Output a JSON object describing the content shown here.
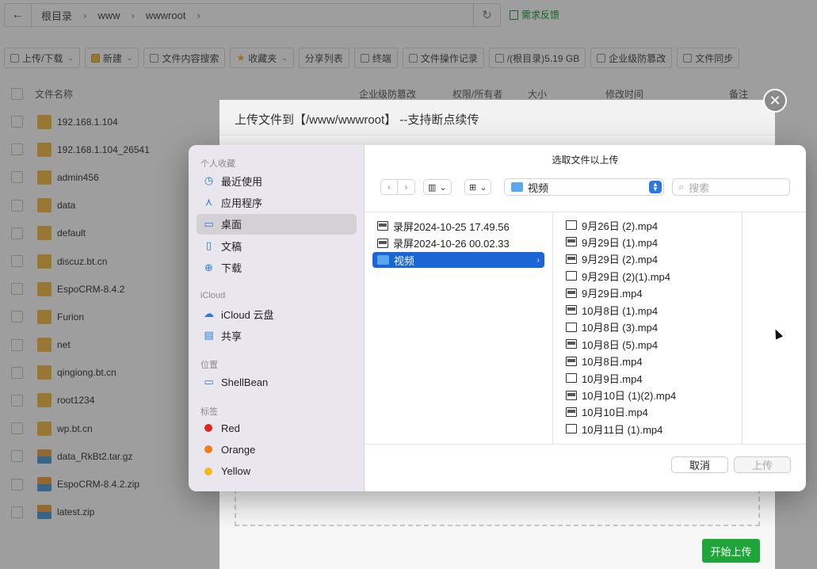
{
  "background": {
    "breadcrumb": [
      "根目录",
      "www",
      "wwwroot"
    ],
    "feedback_label": "需求反馈",
    "toolbar": [
      {
        "label": "上传/下载",
        "caret": true,
        "icon": "upload-icon"
      },
      {
        "label": "新建",
        "caret": true,
        "icon": "folder-icon"
      },
      {
        "label": "文件内容搜索",
        "caret": false,
        "icon": "search-icon"
      },
      {
        "label": "收藏夹",
        "caret": true,
        "icon": "star-icon"
      },
      {
        "label": "分享列表",
        "caret": false,
        "icon": ""
      },
      {
        "label": "终端",
        "caret": false,
        "icon": "terminal-icon"
      },
      {
        "label": "文件操作记录",
        "caret": false,
        "icon": "log-icon"
      },
      {
        "label": "/(根目录)5.19 GB",
        "caret": false,
        "icon": "disk-icon"
      },
      {
        "label": "企业级防篡改",
        "caret": false,
        "icon": "shield-icon"
      },
      {
        "label": "文件同步",
        "caret": false,
        "icon": "sync-icon"
      }
    ],
    "columns": [
      "文件名称",
      "企业级防篡改",
      "权限/所有者",
      "大小",
      "修改时间",
      "备注"
    ],
    "files": [
      {
        "name": "192.168.1.104",
        "type": "folder"
      },
      {
        "name": "192.168.1.104_26541",
        "type": "folder"
      },
      {
        "name": "admin456",
        "type": "folder"
      },
      {
        "name": "data",
        "type": "folder"
      },
      {
        "name": "default",
        "type": "folder"
      },
      {
        "name": "discuz.bt.cn",
        "type": "folder"
      },
      {
        "name": "EspoCRM-8.4.2",
        "type": "folder"
      },
      {
        "name": "Furion",
        "type": "folder"
      },
      {
        "name": "net",
        "type": "folder"
      },
      {
        "name": "qingiong.bt.cn",
        "type": "folder"
      },
      {
        "name": "root1234",
        "type": "folder"
      },
      {
        "name": "wp.bt.cn",
        "type": "folder"
      },
      {
        "name": "data_RkBt2.tar.gz",
        "type": "archive"
      },
      {
        "name": "EspoCRM-8.4.2.zip",
        "type": "archive"
      },
      {
        "name": "latest.zip",
        "type": "archive"
      }
    ]
  },
  "upload_dialog": {
    "title": "上传文件到【/www/wwwroot】 --支持断点续传",
    "start_button": "开始上传"
  },
  "picker": {
    "title": "选取文件以上传",
    "sidebar": {
      "favorites_header": "个人收藏",
      "favorites": [
        {
          "label": "最近使用",
          "icon": "clock-icon"
        },
        {
          "label": "应用程序",
          "icon": "apps-icon"
        },
        {
          "label": "桌面",
          "icon": "desktop-icon",
          "selected": true
        },
        {
          "label": "文稿",
          "icon": "document-icon"
        },
        {
          "label": "下载",
          "icon": "download-icon"
        }
      ],
      "icloud_header": "iCloud",
      "icloud": [
        {
          "label": "iCloud 云盘",
          "icon": "cloud-icon"
        },
        {
          "label": "共享",
          "icon": "shared-folder-icon"
        }
      ],
      "locations_header": "位置",
      "locations": [
        {
          "label": "ShellBean",
          "icon": "drive-icon"
        }
      ],
      "tags_header": "标签",
      "tags": [
        {
          "label": "Red",
          "color": "#e0241f"
        },
        {
          "label": "Orange",
          "color": "#f07e17"
        },
        {
          "label": "Yellow",
          "color": "#f3b81c"
        }
      ]
    },
    "location_popup": "视频",
    "search_placeholder": "搜索",
    "column1": [
      {
        "label": "录屏2024-10-25 17.49.56",
        "icon": "video-file-icon"
      },
      {
        "label": "录屏2024-10-26 00.02.33",
        "icon": "video-file-icon"
      },
      {
        "label": "视频",
        "icon": "folder-icon",
        "selected": true
      }
    ],
    "column2": [
      "9月26日 (2).mp4",
      "9月29日 (1).mp4",
      "9月29日 (2).mp4",
      "9月29日 (2)(1).mp4",
      "9月29日.mp4",
      "10月8日 (1).mp4",
      "10月8日 (3).mp4",
      "10月8日 (5).mp4",
      "10月8日.mp4",
      "10月9日.mp4",
      "10月10日 (1)(2).mp4",
      "10月10日.mp4",
      "10月11日 (1).mp4"
    ],
    "cancel_button": "取消",
    "upload_button": "上传"
  }
}
